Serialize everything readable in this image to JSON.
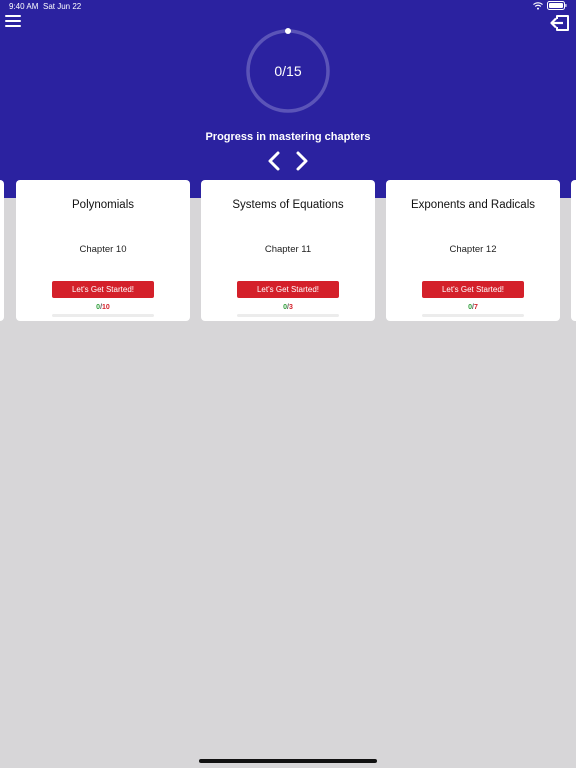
{
  "status_bar": {
    "time": "9:40 AM",
    "date": "Sat Jun 22",
    "battery": "100%"
  },
  "icons": {
    "menu": "hamburger-menu-icon",
    "logout": "logout-icon",
    "prev": "chevron-left-icon",
    "next": "chevron-right-icon"
  },
  "colors": {
    "hero_background": "#2b22a0",
    "page_background": "#d7d6d8",
    "button_red": "#d4202a",
    "count_green": "#2e9e3a"
  },
  "progress": {
    "label": "0/15",
    "completed": 0,
    "total": 15,
    "caption": "Progress in mastering chapters"
  },
  "cards": [
    {
      "title": "Polynomials",
      "chapter": "Chapter 10",
      "button": "Let's Get Started!",
      "done": "0",
      "sep": "/",
      "total": "10",
      "progress_fraction": 0
    },
    {
      "title": "Systems of Equations",
      "chapter": "Chapter 11",
      "button": "Let's Get Started!",
      "done": "0",
      "sep": "/",
      "total": "3",
      "progress_fraction": 0
    },
    {
      "title": "Exponents and Radicals",
      "chapter": "Chapter 12",
      "button": "Let's Get Started!",
      "done": "0",
      "sep": "/",
      "total": "7",
      "progress_fraction": 0
    }
  ]
}
